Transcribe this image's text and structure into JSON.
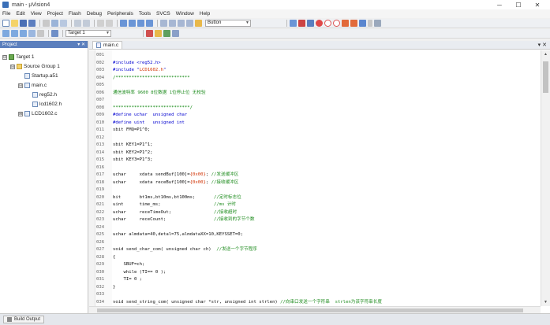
{
  "window": {
    "title": "main - μVision4"
  },
  "menu": [
    "File",
    "Edit",
    "View",
    "Project",
    "Flash",
    "Debug",
    "Peripherals",
    "Tools",
    "SVCS",
    "Window",
    "Help"
  ],
  "toolbar": {
    "find_combo": "Button",
    "target_combo": "Target 1"
  },
  "project_panel": {
    "header": "Project",
    "tree": [
      {
        "label": "Target 1",
        "level": 0,
        "expander": "⊟",
        "icon": "target-icon"
      },
      {
        "label": "Source Group 1",
        "level": 1,
        "expander": "⊟",
        "icon": "folder-icon"
      },
      {
        "label": "Startup.a51",
        "level": 2,
        "expander": "",
        "icon": "file-icon"
      },
      {
        "label": "main.c",
        "level": 2,
        "expander": "⊟",
        "icon": "file-icon"
      },
      {
        "label": "reg52.h",
        "level": 3,
        "expander": "",
        "icon": "file-icon"
      },
      {
        "label": "lcd1602.h",
        "level": 3,
        "expander": "",
        "icon": "file-icon"
      },
      {
        "label": "LCD1602.c",
        "level": 2,
        "expander": "⊞",
        "icon": "file-icon"
      }
    ]
  },
  "editor": {
    "tab": "main.c",
    "lines": [
      {
        "n": "001",
        "parts": []
      },
      {
        "n": "002",
        "parts": [
          {
            "c": "c-blue",
            "s": "#include <reg52.h>"
          }
        ]
      },
      {
        "n": "003",
        "parts": [
          {
            "c": "c-blue",
            "s": "#include \""
          },
          {
            "c": "c-red",
            "s": "LCD1602.h"
          },
          {
            "c": "c-blue",
            "s": "\""
          }
        ]
      },
      {
        "n": "004",
        "parts": [
          {
            "c": "c-green",
            "s": "/****************************"
          }
        ]
      },
      {
        "n": "005",
        "parts": []
      },
      {
        "n": "006",
        "parts": [
          {
            "c": "c-green2",
            "s": "通信波特率 9600 8位数据 1位停止位 无校验"
          }
        ]
      },
      {
        "n": "007",
        "parts": []
      },
      {
        "n": "008",
        "parts": [
          {
            "c": "c-green",
            "s": "*****************************/"
          }
        ]
      },
      {
        "n": "009",
        "parts": [
          {
            "c": "c-blue",
            "s": "#define uchar  unsigned char"
          }
        ]
      },
      {
        "n": "010",
        "parts": [
          {
            "c": "c-blue",
            "s": "#define uint   unsigned int"
          }
        ]
      },
      {
        "n": "011",
        "parts": [
          {
            "c": "c-black",
            "s": "sbit FMQ=P1^0;"
          }
        ]
      },
      {
        "n": "012",
        "parts": []
      },
      {
        "n": "013",
        "parts": [
          {
            "c": "c-black",
            "s": "sbit KEY1=P1^1;"
          }
        ]
      },
      {
        "n": "014",
        "parts": [
          {
            "c": "c-black",
            "s": "sbit KEY2=P1^2;"
          }
        ]
      },
      {
        "n": "015",
        "parts": [
          {
            "c": "c-black",
            "s": "sbit KEY3=P1^3;"
          }
        ]
      },
      {
        "n": "016",
        "parts": []
      },
      {
        "n": "017",
        "parts": [
          {
            "c": "c-black",
            "s": "uchar     xdata sendBuf[100]="
          },
          {
            "c": "c-red",
            "s": "{0x00}"
          },
          {
            "c": "c-black",
            "s": "; "
          },
          {
            "c": "c-green2",
            "s": "//发送缓冲区"
          }
        ]
      },
      {
        "n": "018",
        "parts": [
          {
            "c": "c-black",
            "s": "uchar     xdata receBuf[100]="
          },
          {
            "c": "c-red",
            "s": "{0x00}"
          },
          {
            "c": "c-black",
            "s": "; "
          },
          {
            "c": "c-green2",
            "s": "//接收缓冲区"
          }
        ]
      },
      {
        "n": "019",
        "parts": []
      },
      {
        "n": "020",
        "parts": [
          {
            "c": "c-black",
            "s": "bit       bt1ms,bt10ms,bt100ms;       "
          },
          {
            "c": "c-green2",
            "s": "//定时标志位"
          }
        ]
      },
      {
        "n": "021",
        "parts": [
          {
            "c": "c-black",
            "s": "uint      time_ms;                    "
          },
          {
            "c": "c-green2",
            "s": "//ms 计时"
          }
        ]
      },
      {
        "n": "022",
        "parts": [
          {
            "c": "c-black",
            "s": "uchar     receTimeOut;                "
          },
          {
            "c": "c-green2",
            "s": "//接收超时"
          }
        ]
      },
      {
        "n": "023",
        "parts": [
          {
            "c": "c-black",
            "s": "uchar     receCount;                  "
          },
          {
            "c": "c-green2",
            "s": "//接收到的字节个数"
          }
        ]
      },
      {
        "n": "024",
        "parts": []
      },
      {
        "n": "025",
        "parts": [
          {
            "c": "c-black",
            "s": "uchar almdata=40,detal=75,almdataXX=10,KEYSSET=0;"
          }
        ]
      },
      {
        "n": "026",
        "parts": []
      },
      {
        "n": "027",
        "parts": [
          {
            "c": "c-black",
            "s": "void send_char_com( unsigned char ch)  "
          },
          {
            "c": "c-green2",
            "s": "//发送一个字节程序"
          }
        ]
      },
      {
        "n": "028",
        "parts": [
          {
            "c": "c-black",
            "s": "{"
          }
        ]
      },
      {
        "n": "029",
        "parts": [
          {
            "c": "c-black",
            "s": "    SBUF=ch;"
          }
        ]
      },
      {
        "n": "030",
        "parts": [
          {
            "c": "c-black",
            "s": "    while (TI== 0 );"
          }
        ]
      },
      {
        "n": "031",
        "parts": [
          {
            "c": "c-black",
            "s": "    TI= 0 ;"
          }
        ]
      },
      {
        "n": "032",
        "parts": [
          {
            "c": "c-black",
            "s": "}"
          }
        ]
      },
      {
        "n": "033",
        "parts": []
      },
      {
        "n": "034",
        "parts": [
          {
            "c": "c-black",
            "s": "void send_string_com( unsigned char *str, unsigned int strlen) "
          },
          {
            "c": "c-green2",
            "s": "//向串口发送一个字符串  strlen为该字符串长度"
          }
        ]
      }
    ]
  },
  "bottom": {
    "tab": "Build Output"
  }
}
